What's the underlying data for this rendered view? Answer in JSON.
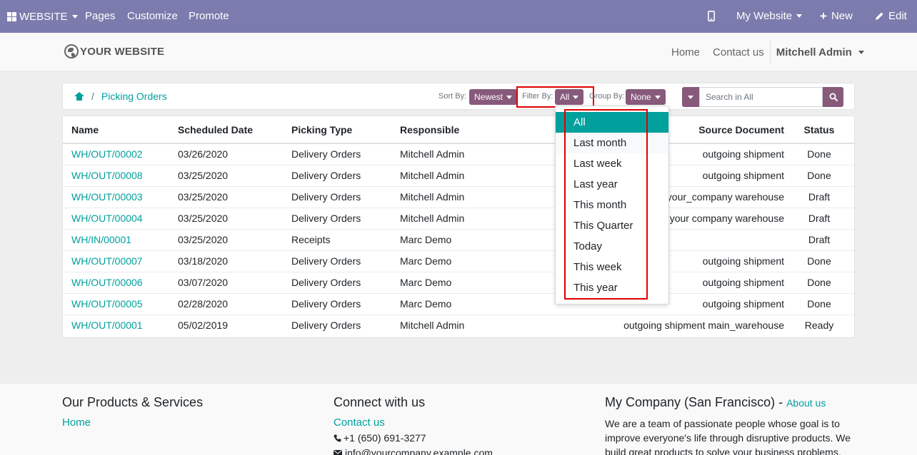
{
  "topbar": {
    "website_menu": "WEBSITE",
    "pages": "Pages",
    "customize": "Customize",
    "promote": "Promote",
    "my_website": "My Website",
    "new": "New",
    "edit": "Edit"
  },
  "header": {
    "logo": "YOUR WEBSITE",
    "home": "Home",
    "contact": "Contact us",
    "user": "Mitchell Admin"
  },
  "breadcrumb": {
    "current": "Picking Orders",
    "separator": "/"
  },
  "controls": {
    "sort_label": "Sort By:",
    "sort_value": "Newest",
    "filter_label": "Filter By:",
    "filter_value": "All",
    "group_label": "Group By:",
    "group_value": "None",
    "search_placeholder": "Search in All"
  },
  "table": {
    "columns": {
      "name": "Name",
      "date": "Scheduled Date",
      "type": "Picking Type",
      "responsible": "Responsible",
      "source": "Source Document",
      "status": "Status"
    },
    "rows": [
      {
        "name": "WH/OUT/00002",
        "date": "03/26/2020",
        "type": "Delivery Orders",
        "responsible": "Mitchell Admin",
        "source": "outgoing shipment",
        "status": "Done"
      },
      {
        "name": "WH/OUT/00008",
        "date": "03/25/2020",
        "type": "Delivery Orders",
        "responsible": "Mitchell Admin",
        "source": "outgoing shipment",
        "status": "Done"
      },
      {
        "name": "WH/OUT/00003",
        "date": "03/25/2020",
        "type": "Delivery Orders",
        "responsible": "Mitchell Admin",
        "source": "your_company warehouse",
        "status": "Draft"
      },
      {
        "name": "WH/OUT/00004",
        "date": "03/25/2020",
        "type": "Delivery Orders",
        "responsible": "Mitchell Admin",
        "source": "your company warehouse",
        "status": "Draft"
      },
      {
        "name": "WH/IN/00001",
        "date": "03/25/2020",
        "type": "Receipts",
        "responsible": "Marc Demo",
        "source": "",
        "status": "Draft"
      },
      {
        "name": "WH/OUT/00007",
        "date": "03/18/2020",
        "type": "Delivery Orders",
        "responsible": "Marc Demo",
        "source": "outgoing shipment",
        "status": "Done"
      },
      {
        "name": "WH/OUT/00006",
        "date": "03/07/2020",
        "type": "Delivery Orders",
        "responsible": "Marc Demo",
        "source": "outgoing shipment",
        "status": "Done"
      },
      {
        "name": "WH/OUT/00005",
        "date": "02/28/2020",
        "type": "Delivery Orders",
        "responsible": "Marc Demo",
        "source": "outgoing shipment",
        "status": "Done"
      },
      {
        "name": "WH/OUT/00001",
        "date": "05/02/2019",
        "type": "Delivery Orders",
        "responsible": "Mitchell Admin",
        "source": "outgoing shipment main_warehouse",
        "status": "Ready"
      }
    ]
  },
  "filter_menu": {
    "items": [
      "All",
      "Last month",
      "Last week",
      "Last year",
      "This month",
      "This Quarter",
      "Today",
      "This week",
      "This year"
    ],
    "active": "All",
    "hovered": "Last month"
  },
  "footer": {
    "col1_title": "Our Products & Services",
    "col1_link": "Home",
    "col2_title": "Connect with us",
    "col2_link": "Contact us",
    "phone": "+1 (650) 691-3277",
    "email": "info@yourcompany.example.com",
    "col3_title": "My Company (San Francisco) - ",
    "col3_link": "About us",
    "col3_text": "We are a team of passionate people whose goal is to improve everyone's life through disruptive products. We build great products to solve your business problems."
  },
  "colors": {
    "topbar": "#7c7bad",
    "accent": "#875a7b",
    "link": "#00a09d",
    "highlight": "#e00000"
  }
}
